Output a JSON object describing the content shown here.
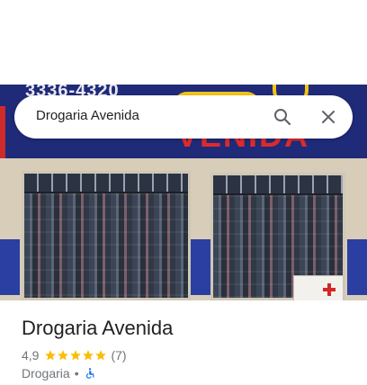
{
  "search": {
    "value": "Drogaria Avenida"
  },
  "photo": {
    "phone_text": "3336-4320",
    "brand_text": "VENIDA"
  },
  "place": {
    "name": "Drogaria Avenida",
    "rating": "4,9",
    "stars": 5,
    "review_count": "(7)",
    "category": "Drogaria",
    "separator": "•",
    "accessibility_icon": "wheelchair-icon"
  },
  "colors": {
    "star": "#fbbc04",
    "accessible": "#1a73e8",
    "text_primary": "#202124",
    "text_secondary": "#70757a"
  }
}
